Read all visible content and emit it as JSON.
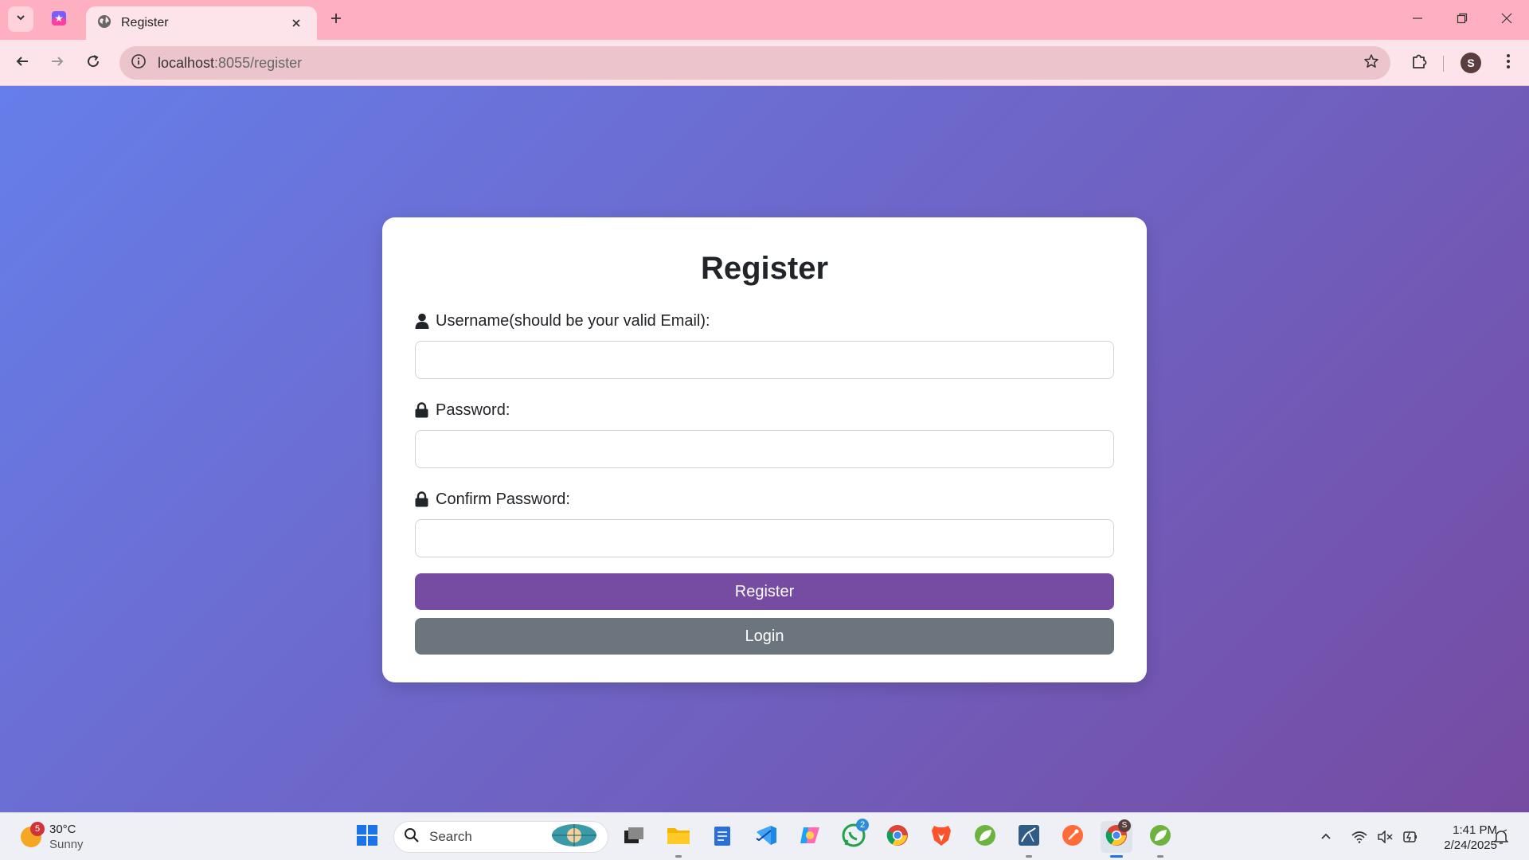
{
  "browser": {
    "tab_title": "Register",
    "url_host": "localhost",
    "url_rest": ":8055/register",
    "profile_initial": "S"
  },
  "page": {
    "heading": "Register",
    "fields": [
      {
        "label": "Username(should be your valid Email):",
        "icon": "user-icon",
        "value": "",
        "placeholder": ""
      },
      {
        "label": "Password:",
        "icon": "lock-icon",
        "value": "",
        "placeholder": ""
      },
      {
        "label": "Confirm Password:",
        "icon": "lock-icon",
        "value": "",
        "placeholder": ""
      }
    ],
    "register_label": "Register",
    "login_label": "Login",
    "colors": {
      "gradient_start": "#667eea",
      "gradient_end": "#764ba2",
      "primary_button": "#764ba2",
      "secondary_button": "#6c757d"
    }
  },
  "taskbar": {
    "weather_temp": "30°C",
    "weather_condition": "Sunny",
    "weather_badge": "5",
    "search_label": "Search",
    "whatsapp_badge": "2",
    "chrome_profile_badge": "S",
    "time": "1:41 PM",
    "date": "2/24/2025"
  }
}
